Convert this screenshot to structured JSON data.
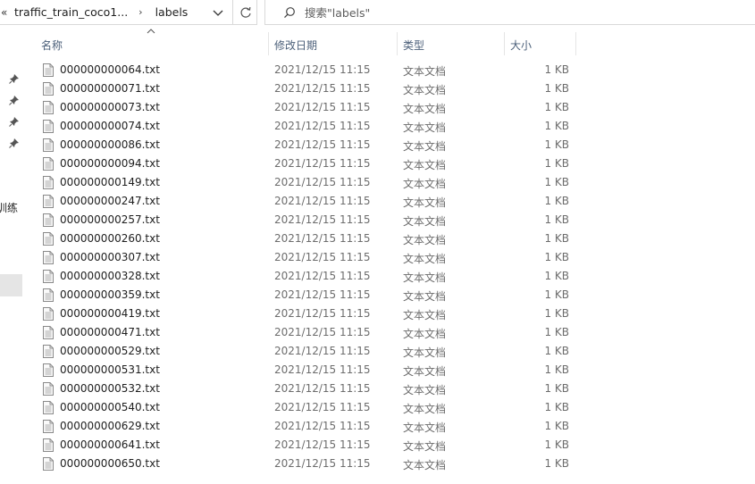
{
  "address_bar": {
    "overflow_glyph": "«",
    "crumbs": [
      "traffic_train_coco1...",
      "labels"
    ],
    "separator": "›"
  },
  "search": {
    "placeholder": "搜索\"labels\""
  },
  "nav": {
    "partial_label": "训练"
  },
  "columns": {
    "name": "名称",
    "date": "修改日期",
    "type": "类型",
    "size": "大小"
  },
  "files": [
    {
      "name": "000000000064.txt",
      "date": "2021/12/15 11:15",
      "type": "文本文档",
      "size": "1 KB"
    },
    {
      "name": "000000000071.txt",
      "date": "2021/12/15 11:15",
      "type": "文本文档",
      "size": "1 KB"
    },
    {
      "name": "000000000073.txt",
      "date": "2021/12/15 11:15",
      "type": "文本文档",
      "size": "1 KB"
    },
    {
      "name": "000000000074.txt",
      "date": "2021/12/15 11:15",
      "type": "文本文档",
      "size": "1 KB"
    },
    {
      "name": "000000000086.txt",
      "date": "2021/12/15 11:15",
      "type": "文本文档",
      "size": "1 KB"
    },
    {
      "name": "000000000094.txt",
      "date": "2021/12/15 11:15",
      "type": "文本文档",
      "size": "1 KB"
    },
    {
      "name": "000000000149.txt",
      "date": "2021/12/15 11:15",
      "type": "文本文档",
      "size": "1 KB"
    },
    {
      "name": "000000000247.txt",
      "date": "2021/12/15 11:15",
      "type": "文本文档",
      "size": "1 KB"
    },
    {
      "name": "000000000257.txt",
      "date": "2021/12/15 11:15",
      "type": "文本文档",
      "size": "1 KB"
    },
    {
      "name": "000000000260.txt",
      "date": "2021/12/15 11:15",
      "type": "文本文档",
      "size": "1 KB"
    },
    {
      "name": "000000000307.txt",
      "date": "2021/12/15 11:15",
      "type": "文本文档",
      "size": "1 KB"
    },
    {
      "name": "000000000328.txt",
      "date": "2021/12/15 11:15",
      "type": "文本文档",
      "size": "1 KB"
    },
    {
      "name": "000000000359.txt",
      "date": "2021/12/15 11:15",
      "type": "文本文档",
      "size": "1 KB"
    },
    {
      "name": "000000000419.txt",
      "date": "2021/12/15 11:15",
      "type": "文本文档",
      "size": "1 KB"
    },
    {
      "name": "000000000471.txt",
      "date": "2021/12/15 11:15",
      "type": "文本文档",
      "size": "1 KB"
    },
    {
      "name": "000000000529.txt",
      "date": "2021/12/15 11:15",
      "type": "文本文档",
      "size": "1 KB"
    },
    {
      "name": "000000000531.txt",
      "date": "2021/12/15 11:15",
      "type": "文本文档",
      "size": "1 KB"
    },
    {
      "name": "000000000532.txt",
      "date": "2021/12/15 11:15",
      "type": "文本文档",
      "size": "1 KB"
    },
    {
      "name": "000000000540.txt",
      "date": "2021/12/15 11:15",
      "type": "文本文档",
      "size": "1 KB"
    },
    {
      "name": "000000000629.txt",
      "date": "2021/12/15 11:15",
      "type": "文本文档",
      "size": "1 KB"
    },
    {
      "name": "000000000641.txt",
      "date": "2021/12/15 11:15",
      "type": "文本文档",
      "size": "1 KB"
    },
    {
      "name": "000000000650.txt",
      "date": "2021/12/15 11:15",
      "type": "文本文档",
      "size": "1 KB"
    }
  ],
  "icons": {
    "file": "text-file-icon",
    "pin": "pin-icon",
    "search": "search-icon",
    "refresh": "refresh-icon",
    "dropdown": "chevron-down-icon",
    "sort": "sort-up-caret-icon"
  }
}
